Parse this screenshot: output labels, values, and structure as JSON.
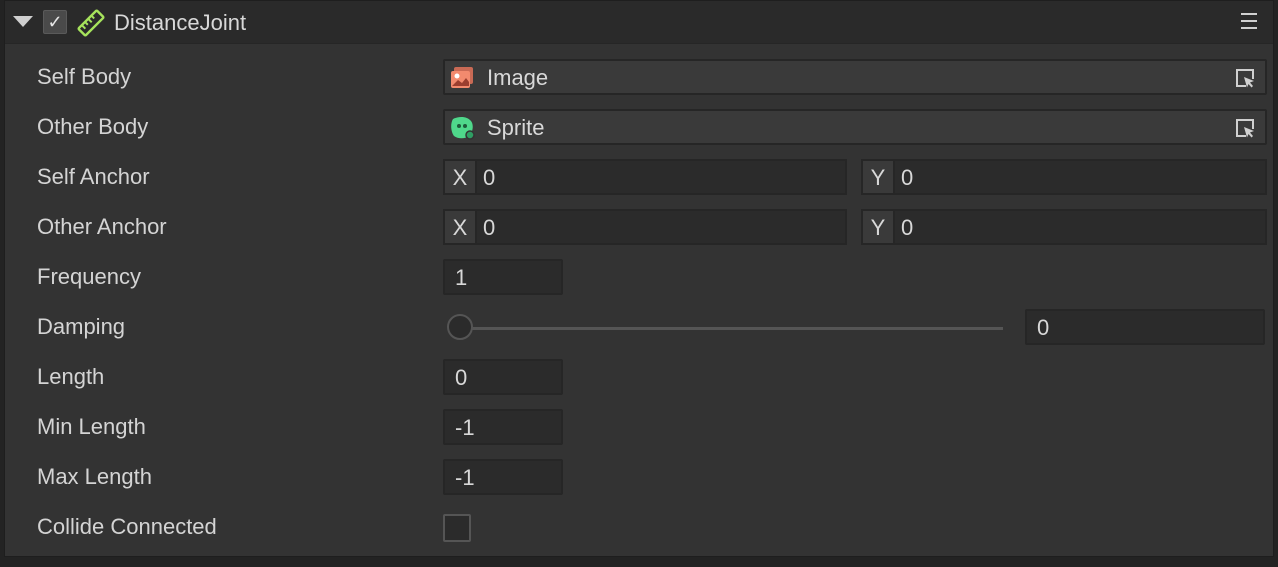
{
  "component": {
    "title": "DistanceJoint",
    "enabled": true,
    "check_glyph": "✓",
    "icon": "ruler-icon",
    "accent_color": "#a6e35c"
  },
  "props": {
    "self_body": {
      "label": "Self Body",
      "value": "Image",
      "icon": "image-asset-icon",
      "icon_color": "#f28a6e"
    },
    "other_body": {
      "label": "Other Body",
      "value": "Sprite",
      "icon": "sprite-asset-icon",
      "icon_color": "#4fd88b"
    },
    "self_anchor": {
      "label": "Self Anchor",
      "x_axis": "X",
      "x": "0",
      "y_axis": "Y",
      "y": "0"
    },
    "other_anchor": {
      "label": "Other Anchor",
      "x_axis": "X",
      "x": "0",
      "y_axis": "Y",
      "y": "0"
    },
    "frequency": {
      "label": "Frequency",
      "value": "1"
    },
    "damping": {
      "label": "Damping",
      "value": "0",
      "slider_fraction": 0
    },
    "length": {
      "label": "Length",
      "value": "0"
    },
    "min_length": {
      "label": "Min Length",
      "value": "-1"
    },
    "max_length": {
      "label": "Max Length",
      "value": "-1"
    },
    "collide_connected": {
      "label": "Collide Connected",
      "checked": false
    }
  }
}
